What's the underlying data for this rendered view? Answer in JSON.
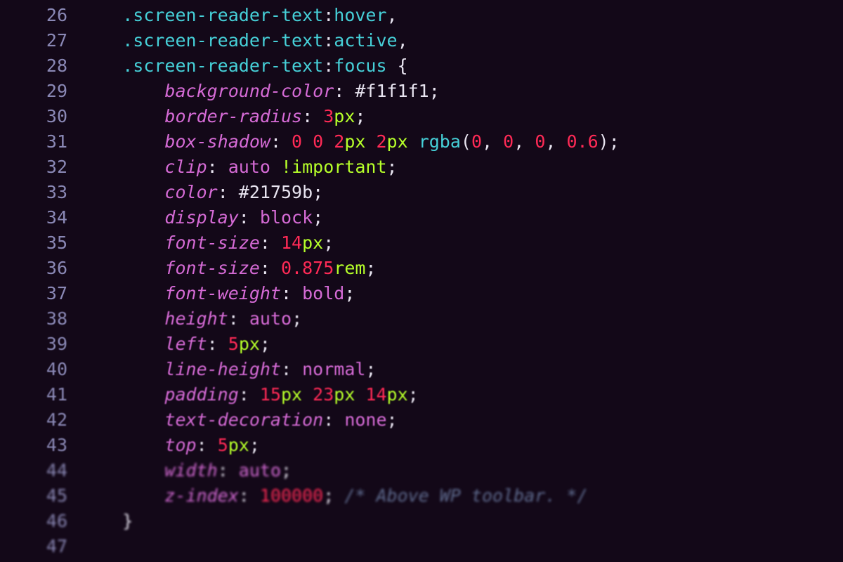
{
  "lines": [
    {
      "num": "26",
      "indent": 4,
      "blur": "",
      "tokens": [
        {
          "cls": "sel",
          "t": ".screen-reader-text"
        },
        {
          "cls": "punc",
          "t": ":"
        },
        {
          "cls": "sel",
          "t": "hover"
        },
        {
          "cls": "comma",
          "t": ","
        }
      ]
    },
    {
      "num": "27",
      "indent": 4,
      "blur": "",
      "tokens": [
        {
          "cls": "sel",
          "t": ".screen-reader-text"
        },
        {
          "cls": "punc",
          "t": ":"
        },
        {
          "cls": "sel",
          "t": "active"
        },
        {
          "cls": "comma",
          "t": ","
        }
      ]
    },
    {
      "num": "28",
      "indent": 4,
      "blur": "",
      "tokens": [
        {
          "cls": "sel",
          "t": ".screen-reader-text"
        },
        {
          "cls": "punc",
          "t": ":"
        },
        {
          "cls": "sel",
          "t": "focus"
        },
        {
          "cls": "brace",
          "t": " {"
        }
      ]
    },
    {
      "num": "29",
      "indent": 8,
      "blur": "",
      "tokens": [
        {
          "cls": "prop",
          "t": "background-color"
        },
        {
          "cls": "punc",
          "t": ": "
        },
        {
          "cls": "hex",
          "t": "#f1f1f1"
        },
        {
          "cls": "punc",
          "t": ";"
        }
      ]
    },
    {
      "num": "30",
      "indent": 8,
      "blur": "",
      "tokens": [
        {
          "cls": "prop",
          "t": "border-radius"
        },
        {
          "cls": "punc",
          "t": ": "
        },
        {
          "cls": "num",
          "t": "3"
        },
        {
          "cls": "unit",
          "t": "px"
        },
        {
          "cls": "punc",
          "t": ";"
        }
      ]
    },
    {
      "num": "31",
      "indent": 8,
      "blur": "",
      "tokens": [
        {
          "cls": "prop",
          "t": "box-shadow"
        },
        {
          "cls": "punc",
          "t": ": "
        },
        {
          "cls": "num",
          "t": "0 0 "
        },
        {
          "cls": "num",
          "t": "2"
        },
        {
          "cls": "unit",
          "t": "px "
        },
        {
          "cls": "num",
          "t": "2"
        },
        {
          "cls": "unit",
          "t": "px "
        },
        {
          "cls": "fn",
          "t": "rgba"
        },
        {
          "cls": "punc",
          "t": "("
        },
        {
          "cls": "num",
          "t": "0"
        },
        {
          "cls": "punc",
          "t": ", "
        },
        {
          "cls": "num",
          "t": "0"
        },
        {
          "cls": "punc",
          "t": ", "
        },
        {
          "cls": "num",
          "t": "0"
        },
        {
          "cls": "punc",
          "t": ", "
        },
        {
          "cls": "num",
          "t": "0.6"
        },
        {
          "cls": "punc",
          "t": ")"
        },
        {
          "cls": "punc",
          "t": ";"
        }
      ]
    },
    {
      "num": "32",
      "indent": 8,
      "blur": "",
      "tokens": [
        {
          "cls": "prop",
          "t": "clip"
        },
        {
          "cls": "punc",
          "t": ": "
        },
        {
          "cls": "kw",
          "t": "auto "
        },
        {
          "cls": "imp",
          "t": "!important"
        },
        {
          "cls": "punc",
          "t": ";"
        }
      ]
    },
    {
      "num": "33",
      "indent": 8,
      "blur": "",
      "tokens": [
        {
          "cls": "prop",
          "t": "color"
        },
        {
          "cls": "punc",
          "t": ": "
        },
        {
          "cls": "hex",
          "t": "#21759b"
        },
        {
          "cls": "punc",
          "t": ";"
        }
      ]
    },
    {
      "num": "34",
      "indent": 8,
      "blur": "",
      "tokens": [
        {
          "cls": "prop",
          "t": "display"
        },
        {
          "cls": "punc",
          "t": ": "
        },
        {
          "cls": "kw",
          "t": "block"
        },
        {
          "cls": "punc",
          "t": ";"
        }
      ]
    },
    {
      "num": "35",
      "indent": 8,
      "blur": "",
      "tokens": [
        {
          "cls": "prop",
          "t": "font-size"
        },
        {
          "cls": "punc",
          "t": ": "
        },
        {
          "cls": "num",
          "t": "14"
        },
        {
          "cls": "unit",
          "t": "px"
        },
        {
          "cls": "punc",
          "t": ";"
        }
      ]
    },
    {
      "num": "36",
      "indent": 8,
      "blur": "",
      "tokens": [
        {
          "cls": "prop",
          "t": "font-size"
        },
        {
          "cls": "punc",
          "t": ": "
        },
        {
          "cls": "num",
          "t": "0.875"
        },
        {
          "cls": "unit",
          "t": "rem"
        },
        {
          "cls": "punc",
          "t": ";"
        }
      ]
    },
    {
      "num": "37",
      "indent": 8,
      "blur": "",
      "tokens": [
        {
          "cls": "prop",
          "t": "font-weight"
        },
        {
          "cls": "punc",
          "t": ": "
        },
        {
          "cls": "kw",
          "t": "bold"
        },
        {
          "cls": "punc",
          "t": ";"
        }
      ]
    },
    {
      "num": "38",
      "indent": 8,
      "blur": "blurA",
      "tokens": [
        {
          "cls": "prop",
          "t": "height"
        },
        {
          "cls": "punc",
          "t": ": "
        },
        {
          "cls": "kw",
          "t": "auto"
        },
        {
          "cls": "punc",
          "t": ";"
        }
      ]
    },
    {
      "num": "39",
      "indent": 8,
      "blur": "blurA",
      "tokens": [
        {
          "cls": "prop",
          "t": "left"
        },
        {
          "cls": "punc",
          "t": ": "
        },
        {
          "cls": "num",
          "t": "5"
        },
        {
          "cls": "unit",
          "t": "px"
        },
        {
          "cls": "punc",
          "t": ";"
        }
      ]
    },
    {
      "num": "40",
      "indent": 8,
      "blur": "blurA",
      "tokens": [
        {
          "cls": "prop",
          "t": "line-height"
        },
        {
          "cls": "punc",
          "t": ": "
        },
        {
          "cls": "kw",
          "t": "normal"
        },
        {
          "cls": "punc",
          "t": ";"
        }
      ]
    },
    {
      "num": "41",
      "indent": 8,
      "blur": "blurB",
      "tokens": [
        {
          "cls": "prop",
          "t": "padding"
        },
        {
          "cls": "punc",
          "t": ": "
        },
        {
          "cls": "num",
          "t": "15"
        },
        {
          "cls": "unit",
          "t": "px "
        },
        {
          "cls": "num",
          "t": "23"
        },
        {
          "cls": "unit",
          "t": "px "
        },
        {
          "cls": "num",
          "t": "14"
        },
        {
          "cls": "unit",
          "t": "px"
        },
        {
          "cls": "punc",
          "t": ";"
        }
      ]
    },
    {
      "num": "42",
      "indent": 8,
      "blur": "blurB",
      "tokens": [
        {
          "cls": "prop",
          "t": "text-decoration"
        },
        {
          "cls": "punc",
          "t": ": "
        },
        {
          "cls": "kw",
          "t": "none"
        },
        {
          "cls": "punc",
          "t": ";"
        }
      ]
    },
    {
      "num": "43",
      "indent": 8,
      "blur": "blurB",
      "tokens": [
        {
          "cls": "prop",
          "t": "top"
        },
        {
          "cls": "punc",
          "t": ": "
        },
        {
          "cls": "num",
          "t": "5"
        },
        {
          "cls": "unit",
          "t": "px"
        },
        {
          "cls": "punc",
          "t": ";"
        }
      ]
    },
    {
      "num": "44",
      "indent": 8,
      "blur": "blurC",
      "tokens": [
        {
          "cls": "prop",
          "t": "width"
        },
        {
          "cls": "punc",
          "t": ": "
        },
        {
          "cls": "kw",
          "t": "auto"
        },
        {
          "cls": "punc",
          "t": ";"
        }
      ]
    },
    {
      "num": "45",
      "indent": 8,
      "blur": "blurC",
      "tokens": [
        {
          "cls": "prop",
          "t": "z-index"
        },
        {
          "cls": "punc",
          "t": ": "
        },
        {
          "cls": "num",
          "t": "100000"
        },
        {
          "cls": "punc",
          "t": "; "
        },
        {
          "cls": "cmt",
          "t": "/* Above WP toolbar. */"
        }
      ]
    },
    {
      "num": "46",
      "indent": 4,
      "blur": "blurC",
      "tokens": [
        {
          "cls": "brace",
          "t": "}"
        }
      ]
    },
    {
      "num": "47",
      "indent": 0,
      "blur": "blurC",
      "tokens": []
    }
  ]
}
